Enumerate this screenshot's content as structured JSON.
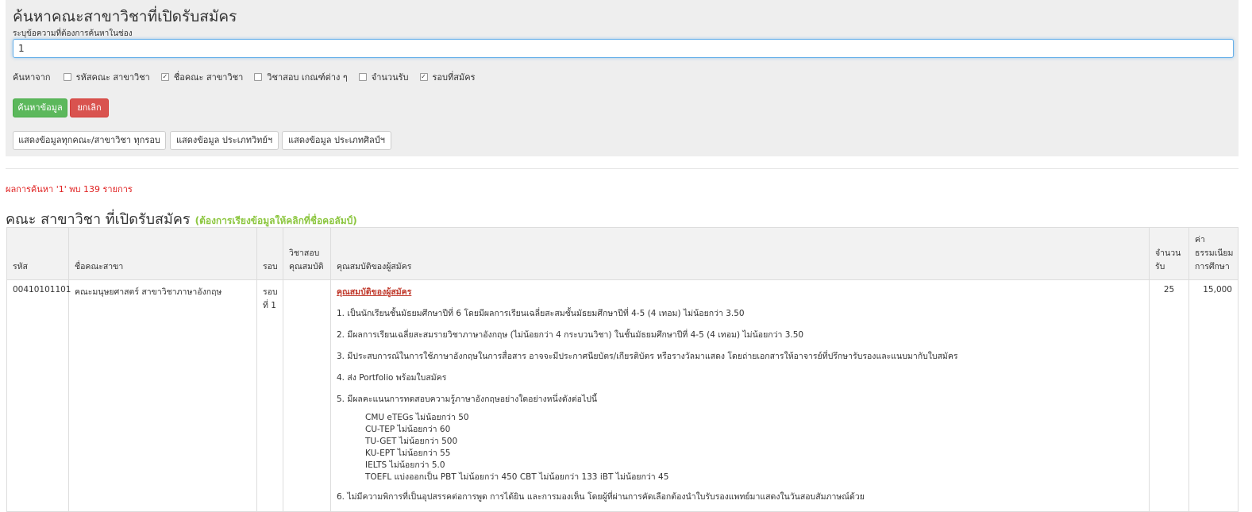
{
  "search": {
    "title": "ค้นหาคณะสาขาวิชาที่เปิดรับสมัคร",
    "hint": "ระบุข้อความที่ต้องการค้นหาในช่อง",
    "value": "1",
    "filter_label": "ค้นหาจาก",
    "filters": [
      {
        "label": "รหัสคณะ สาขาวิชา",
        "checked": false
      },
      {
        "label": "ชื่อคณะ สาขาวิชา",
        "checked": true
      },
      {
        "label": "วิชาสอบ เกณฑ์ต่าง ๆ",
        "checked": false
      },
      {
        "label": "จำนวนรับ",
        "checked": false
      },
      {
        "label": "รอบที่สมัคร",
        "checked": true
      }
    ],
    "search_button": "ค้นหาข้อมูล",
    "cancel_button": "ยกเลิก",
    "show_all": "แสดงข้อมูลทุกคณะ/สาขาวิชา ทุกรอบ",
    "show_science": "แสดงข้อมูล ประเภทวิทย์ฯ",
    "show_arts": "แสดงข้อมูล ประเภทศิลป์ฯ"
  },
  "result_text": "ผลการค้นหา '1' พบ 139 รายการ",
  "heading": {
    "title": "คณะ สาขาวิชา ที่เปิดรับสมัคร",
    "note": "(ต้องการเรียงข้อมูลให้คลิกที่ชื่อคอลัมป์)"
  },
  "table": {
    "headers": {
      "code": "รหัส",
      "name": "ชื่อคณะสาขา",
      "round": "รอบ",
      "exam": "วิชาสอบ คุณสมบัติ",
      "qual": "คุณสมบัติของผู้สมัคร",
      "quota": "จำนวน รับ",
      "fee": "ค่า ธรรมเนียม การศึกษา"
    },
    "row": {
      "code": "00410101101",
      "name": "คณะมนุษยศาสตร์ สาขาวิชาภาษาอังกฤษ",
      "round": "รอบ ที่ 1",
      "exam": "",
      "qual_title": "คุณสมบัติของผู้สมัคร",
      "q1": "1. เป็นนักเรียนชั้นมัธยมศึกษาปีที่ 6 โดยมีผลการเรียนเฉลี่ยสะสมชั้นมัธยมศึกษาปีที่ 4-5 (4 เทอม) ไม่น้อยกว่า 3.50",
      "q2": "2. มีผลการเรียนเฉลี่ยสะสมรายวิชาภาษาอังกฤษ (ไม่น้อยกว่า 4 กระบวนวิชา) ในชั้นมัธยมศึกษาปีที่ 4-5 (4 เทอม) ไม่น้อยกว่า 3.50",
      "q3": "3. มีประสบการณ์ในการใช้ภาษาอังกฤษในการสื่อสาร อาจจะมีประกาศนียบัตร/เกียรติบัตร หรือรางวัลมาแสดง โดยถ่ายเอกสารให้อาจารย์ที่ปรึกษารับรองและแนบมากับใบสมัคร",
      "q4": "4. ส่ง Portfolio พร้อมใบสมัคร",
      "q5": "5. มีผลคะแนนการทดสอบความรู้ภาษาอังกฤษอย่างใดอย่างหนึ่งดังต่อไปนี้",
      "t1": "CMU eTEGs ไม่น้อยกว่า 50",
      "t2": "CU-TEP ไม่น้อยกว่า 60",
      "t3": "TU-GET ไม่น้อยกว่า 500",
      "t4": "KU-EPT ไม่น้อยกว่า 55",
      "t5": "IELTS ไม่น้อยกว่า 5.0",
      "t6": "TOEFL แบ่งออกเป็น PBT ไม่น้อยกว่า 450 CBT ไม่น้อยกว่า 133 iBT ไม่น้อยกว่า 45",
      "q6": "6. ไม่มีความพิการที่เป็นอุปสรรคต่อการพูด การได้ยิน และการมองเห็น โดยผู้ที่ผ่านการคัดเลือกต้องนำใบรับรองแพทย์มาแสดงในวันสอบสัมภาษณ์ด้วย",
      "quota": "25",
      "fee": "15,000"
    }
  }
}
